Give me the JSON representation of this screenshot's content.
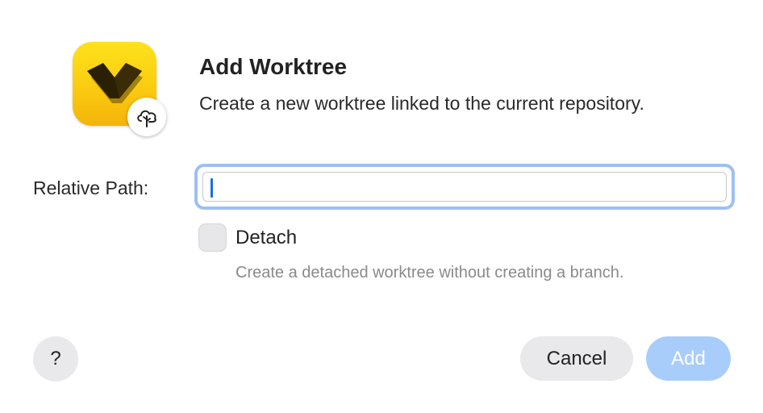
{
  "dialog": {
    "title": "Add Worktree",
    "subtitle": "Create a new worktree linked to the current repository.",
    "app_icon": "yellow-app-icon-with-chevron",
    "badge_icon": "cloud-tree-icon"
  },
  "form": {
    "relative_path": {
      "label": "Relative Path:",
      "value": "",
      "focused": true
    },
    "detach": {
      "label": "Detach",
      "checked": false,
      "hint": "Create a detached worktree without creating a branch."
    }
  },
  "buttons": {
    "help_label": "?",
    "cancel_label": "Cancel",
    "add_label": "Add",
    "add_enabled": false
  },
  "colors": {
    "accent": "#1a6de6",
    "focus_ring": "#9ec0f2",
    "add_disabled": "#a9cdfb",
    "icon_yellow": "#fcd015"
  }
}
